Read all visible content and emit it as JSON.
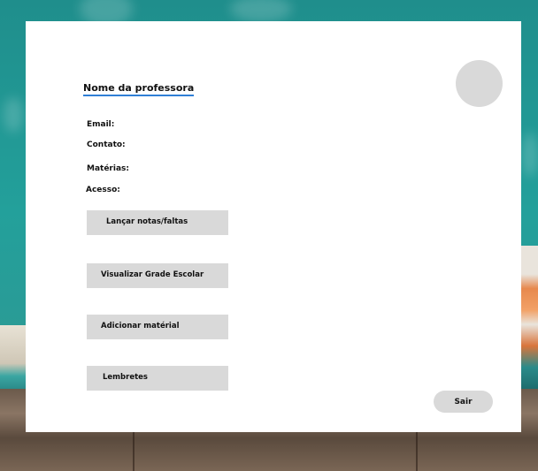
{
  "profile": {
    "title": "Nome da professora",
    "fields": {
      "email_label": "Email:",
      "contact_label": "Contato:",
      "subjects_label": "Matérias:",
      "access_label": "Acesso:"
    }
  },
  "menu": {
    "items": [
      {
        "label": "Lançar notas/faltas"
      },
      {
        "label": "Visualizar Grade Escolar"
      },
      {
        "label": "Adicionar matérial"
      },
      {
        "label": "Lembretes"
      }
    ]
  },
  "actions": {
    "logout_label": "Sair"
  },
  "colors": {
    "title_underline": "#2f7fd6",
    "button_bg": "#d9d9d9",
    "card_bg": "#ffffff",
    "background": "#23a09b"
  }
}
